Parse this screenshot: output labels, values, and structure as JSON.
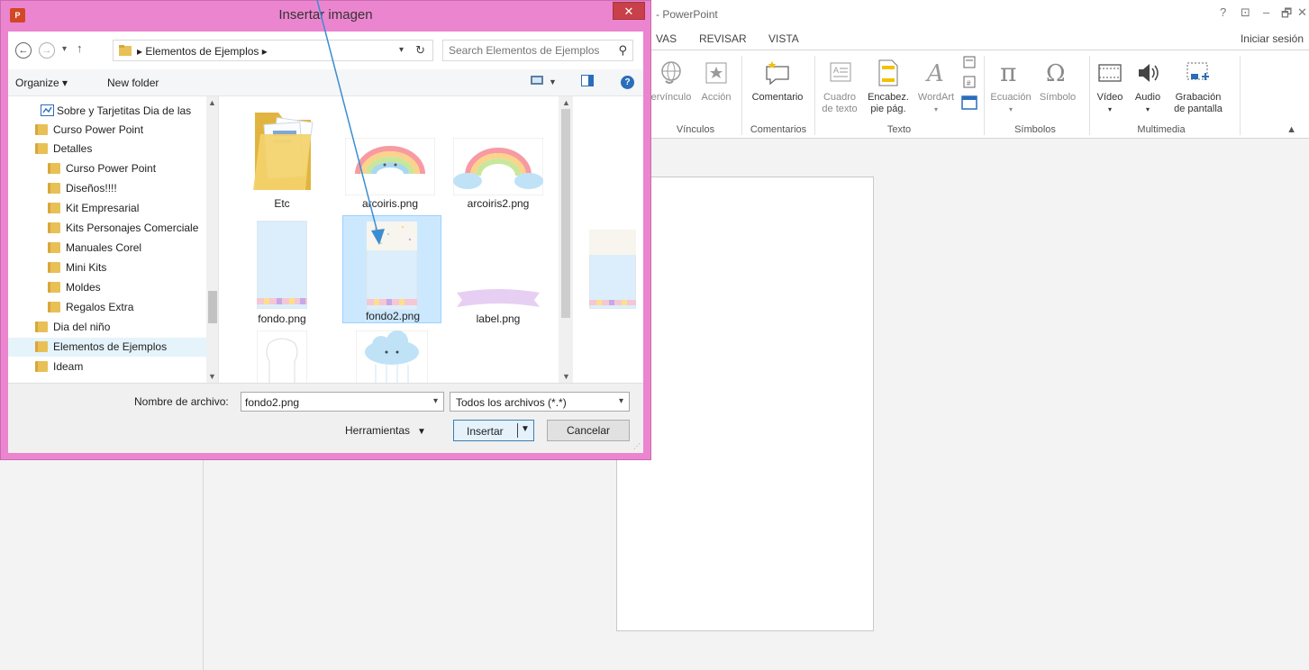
{
  "powerpoint": {
    "title": "- PowerPoint",
    "window_controls": [
      "?",
      "⊡",
      "–",
      "🗗",
      "✕"
    ],
    "tabs": [
      "VAS",
      "REVISAR",
      "VISTA"
    ],
    "sign_in": "Iniciar sesión",
    "ribbon": {
      "buttons": [
        {
          "label": "ervínculo",
          "icon": "hyperlink-icon",
          "dim": true
        },
        {
          "label": "Acción",
          "icon": "action-icon",
          "dim": true
        },
        {
          "label": "Comentario",
          "icon": "comment-icon"
        },
        {
          "label": "Cuadro de texto",
          "icon": "textbox-icon",
          "dim": true
        },
        {
          "label": "Encabez. pie pág.",
          "icon": "header-footer-icon"
        },
        {
          "label": "WordArt",
          "icon": "wordart-icon",
          "dim": true
        },
        {
          "label": "Ecuación",
          "icon": "equation-icon",
          "dim": true
        },
        {
          "label": "Símbolo",
          "icon": "symbol-icon",
          "dim": true
        },
        {
          "label": "Vídeo",
          "icon": "video-icon"
        },
        {
          "label": "Audio",
          "icon": "audio-icon"
        },
        {
          "label": "Grabación de pantalla",
          "icon": "screen-recording-icon"
        }
      ],
      "groups": [
        "Vínculos",
        "Comentarios",
        "Texto",
        "Símbolos",
        "Multimedia"
      ]
    }
  },
  "dialog": {
    "title": "Insertar imagen",
    "app_badge": "P",
    "close_label": "✕",
    "address": {
      "breadcrumb": "Elementos de Ejemplos",
      "search_placeholder": "Search Elementos de Ejemplos"
    },
    "commands": {
      "organize": "Organize ▾",
      "new_folder": "New folder"
    },
    "nav_items": [
      {
        "label": "Sobre y Tarjetitas Dia de las",
        "indent": 2,
        "special": true
      },
      {
        "label": "Curso Power Point",
        "indent": 1
      },
      {
        "label": "Detalles",
        "indent": 1
      },
      {
        "label": "Curso Power Point",
        "indent": 2
      },
      {
        "label": "Diseños!!!!",
        "indent": 2
      },
      {
        "label": "Kit Empresarial",
        "indent": 2
      },
      {
        "label": "Kits Personajes Comerciale",
        "indent": 2
      },
      {
        "label": "Manuales Corel",
        "indent": 2
      },
      {
        "label": "Mini Kits",
        "indent": 2
      },
      {
        "label": "Moldes",
        "indent": 2
      },
      {
        "label": "Regalos Extra",
        "indent": 2
      },
      {
        "label": "Dia del niño",
        "indent": 1
      },
      {
        "label": "Elementos de Ejemplos",
        "indent": 1,
        "selected": true
      },
      {
        "label": "Ideam",
        "indent": 1
      }
    ],
    "files": [
      {
        "name": "Etc",
        "kind": "folder"
      },
      {
        "name": "arcoiris.png",
        "kind": "rainbow"
      },
      {
        "name": "arcoiris2.png",
        "kind": "rainbow-cloud"
      },
      {
        "name": "fondo.png",
        "kind": "background"
      },
      {
        "name": "fondo2.png",
        "kind": "background2",
        "selected": true
      },
      {
        "name": "label.png",
        "kind": "label"
      },
      {
        "name": "",
        "kind": "outline"
      },
      {
        "name": "",
        "kind": "cloud"
      },
      {
        "name": "",
        "kind": "background-partial"
      }
    ],
    "footer": {
      "filename_label": "Nombre de archivo:",
      "filename_value": "fondo2.png",
      "filter_value": "Todos los archivos (*.*)",
      "tools_label": "Herramientas",
      "insert_label": "Insertar",
      "cancel_label": "Cancelar"
    }
  },
  "colors": {
    "dialog_frame": "#ec85cf",
    "close_button": "#c7404a",
    "selection": "#cce8ff",
    "annotation_arrow": "#3b8dd1"
  }
}
